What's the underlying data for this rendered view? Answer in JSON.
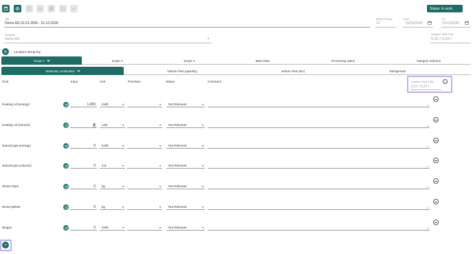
{
  "toolbar": {
    "buttons": [
      {
        "icon": "save-icon",
        "state": "enabled"
      },
      {
        "icon": "target-icon",
        "state": "enabled"
      },
      {
        "icon": "document-icon",
        "state": "disabled"
      },
      {
        "icon": "chart-icon",
        "state": "disabled"
      },
      {
        "icon": "copy-icon",
        "state": "disabled"
      },
      {
        "icon": "folder-icon",
        "state": "disabled"
      },
      {
        "icon": "check-icon",
        "state": "disabled"
      }
    ],
    "status": "Status: In work"
  },
  "header": {
    "title_label": "Title",
    "title_value": "Demo AG 01.01.2026 - 31.12.2026",
    "periods_label": "Reform Periods",
    "periods_value": "12",
    "from_label": "From",
    "from_value": "01/01/2026",
    "to_label": "To",
    "to_value": "31/12/2026",
    "company_label": "Company",
    "company_value": "Demo AG",
    "total_label": "Location / Total CO2e",
    "total_value": "0.32 / 0.32 t"
  },
  "location_hierarchy": "Location hierarchy",
  "scope_tabs": [
    "Scope 1",
    "Scope 2",
    "Scope 3",
    "Base Data",
    "Processing status",
    "Category selection"
  ],
  "sub_tabs": [
    "Stationary combustion",
    "Vehicle Fleet (quantity)",
    "Vehicle Fleet (km)",
    "Refrigerants"
  ],
  "columns": {
    "kind": "Kind",
    "input": "Input",
    "unit": "Unit",
    "precision": "Precision",
    "status": "Status",
    "comment": "Comment"
  },
  "subtotal": {
    "label": "Location / Total CO2e",
    "value": "0.27 / 0.27 t"
  },
  "rows": [
    {
      "kind": "Heating oil (energy)",
      "input": "1,000",
      "unit": "KWh",
      "precision": "",
      "status": "Not Relevant",
      "comment": ""
    },
    {
      "kind": "Heating oil (volume)",
      "input": "0",
      "unit": "Liter",
      "precision": "",
      "status": "Not Relevant",
      "comment": ""
    },
    {
      "kind": "Natural gas (energy)",
      "input": "0",
      "unit": "KWh",
      "precision": "",
      "status": "Not Relevant",
      "comment": ""
    },
    {
      "kind": "Natural gas (volume)",
      "input": "0",
      "unit": "m3",
      "precision": "",
      "status": "Not Relevant",
      "comment": ""
    },
    {
      "kind": "Wood chips",
      "input": "0",
      "unit": "kg",
      "precision": "",
      "status": "Not Relevant",
      "comment": ""
    },
    {
      "kind": "Wood pellets",
      "input": "0",
      "unit": "kg",
      "precision": "",
      "status": "Not Relevant",
      "comment": ""
    },
    {
      "kind": "Biogas",
      "input": "0",
      "unit": "KWh",
      "precision": "",
      "status": "Not Relevant",
      "comment": ""
    }
  ],
  "add_button": "+",
  "colors": {
    "accent": "#1f6b66",
    "highlight": "#b7b3ea"
  }
}
